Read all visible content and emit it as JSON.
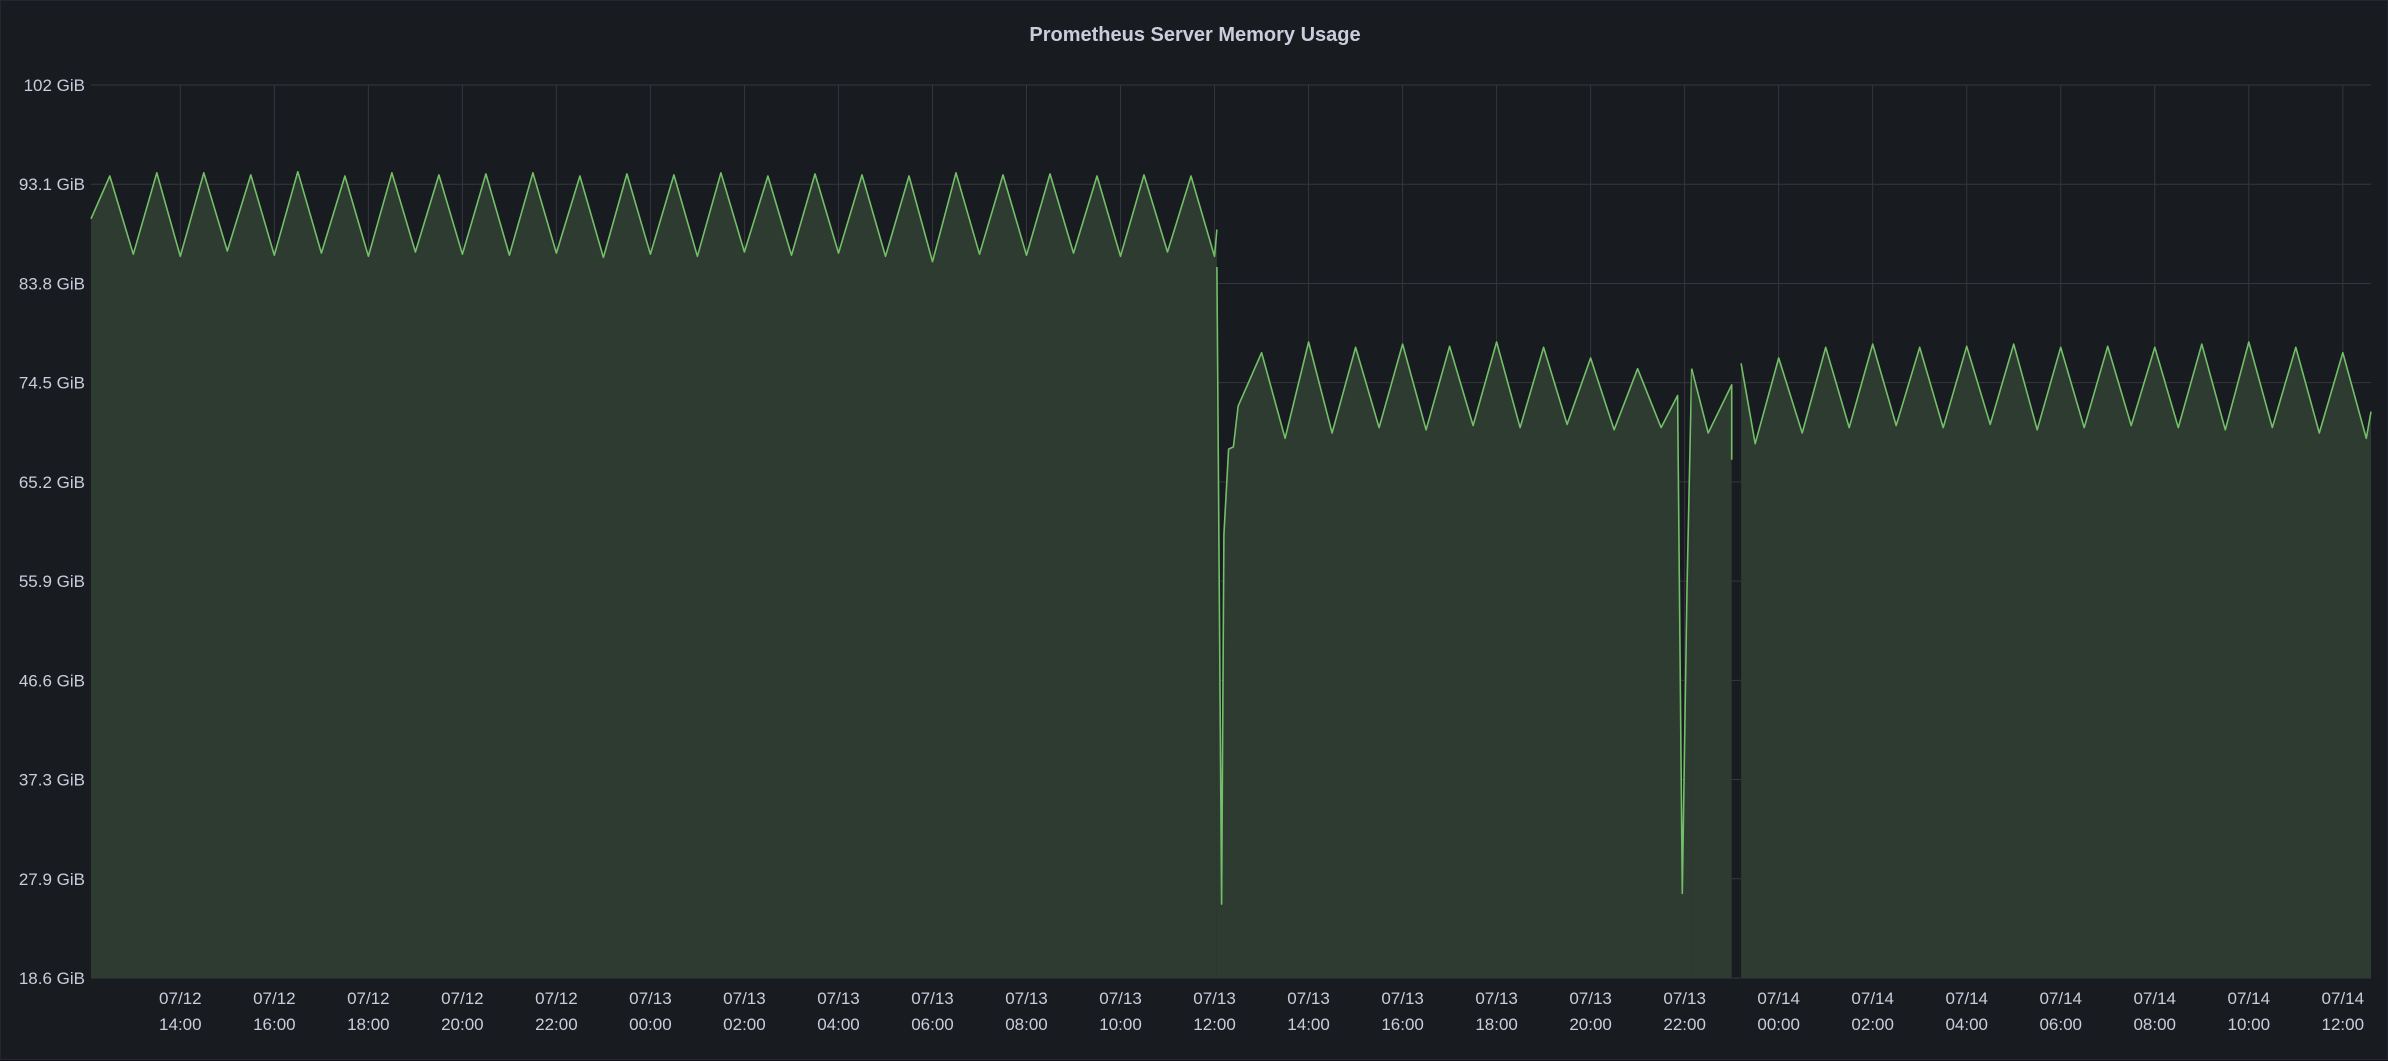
{
  "panel": {
    "title": "Prometheus Server Memory Usage"
  },
  "colors": {
    "background": "#181b1f",
    "grid": "#34373d",
    "series_line": "#73bf69",
    "series_fill": "#2e3b30",
    "gap": "#181b1f",
    "text": "#ccccdc"
  },
  "chart_data": {
    "type": "area",
    "title": "Prometheus Server Memory Usage",
    "xlabel": "",
    "ylabel": "",
    "unit": "GiB",
    "grid": true,
    "legend": "none",
    "ylim": [
      18.6,
      102
    ],
    "yticks": [
      "102 GiB",
      "93.1 GiB",
      "83.8 GiB",
      "74.5 GiB",
      "65.2 GiB",
      "55.9 GiB",
      "46.6 GiB",
      "37.3 GiB",
      "27.9 GiB",
      "18.6 GiB"
    ],
    "x_range_hours": [
      -1.9,
      46.6
    ],
    "x_units": "hours after 07/12 14:00",
    "xticks": [
      {
        "date": "07/12",
        "time": "14:00"
      },
      {
        "date": "07/12",
        "time": "16:00"
      },
      {
        "date": "07/12",
        "time": "18:00"
      },
      {
        "date": "07/12",
        "time": "20:00"
      },
      {
        "date": "07/12",
        "time": "22:00"
      },
      {
        "date": "07/13",
        "time": "00:00"
      },
      {
        "date": "07/13",
        "time": "02:00"
      },
      {
        "date": "07/13",
        "time": "04:00"
      },
      {
        "date": "07/13",
        "time": "06:00"
      },
      {
        "date": "07/13",
        "time": "08:00"
      },
      {
        "date": "07/13",
        "time": "10:00"
      },
      {
        "date": "07/13",
        "time": "12:00"
      },
      {
        "date": "07/13",
        "time": "14:00"
      },
      {
        "date": "07/13",
        "time": "16:00"
      },
      {
        "date": "07/13",
        "time": "18:00"
      },
      {
        "date": "07/13",
        "time": "20:00"
      },
      {
        "date": "07/13",
        "time": "22:00"
      },
      {
        "date": "07/14",
        "time": "00:00"
      },
      {
        "date": "07/14",
        "time": "02:00"
      },
      {
        "date": "07/14",
        "time": "04:00"
      },
      {
        "date": "07/14",
        "time": "06:00"
      },
      {
        "date": "07/14",
        "time": "08:00"
      },
      {
        "date": "07/14",
        "time": "10:00"
      },
      {
        "date": "07/14",
        "time": "12:00"
      }
    ],
    "series": [
      {
        "segments": [
          {
            "x": [
              -1.9,
              -1.5,
              -1.0,
              -0.5,
              0.0,
              0.5,
              1.0,
              1.5,
              2.0,
              2.5,
              3.0,
              3.5,
              4.0,
              4.5,
              5.0,
              5.5,
              6.0,
              6.5,
              7.0,
              7.5,
              8.0,
              8.5,
              9.0,
              9.5,
              10.0,
              10.5,
              11.0,
              11.5,
              12.0,
              12.5,
              13.0,
              13.5,
              14.0,
              14.5,
              15.0,
              15.5,
              16.0,
              16.5,
              17.0,
              17.5,
              18.0,
              18.5,
              19.0,
              19.5,
              20.0,
              20.5,
              21.0,
              21.5,
              22.0,
              22.05
            ],
            "y": [
              89.5,
              93.5,
              86.2,
              93.8,
              86.0,
              93.8,
              86.5,
              93.6,
              86.1,
              93.9,
              86.3,
              93.5,
              86.0,
              93.8,
              86.4,
              93.6,
              86.2,
              93.7,
              86.1,
              93.8,
              86.3,
              93.5,
              85.9,
              93.7,
              86.2,
              93.6,
              86.0,
              93.8,
              86.4,
              93.5,
              86.1,
              93.7,
              86.3,
              93.6,
              86.0,
              93.5,
              85.5,
              93.8,
              86.2,
              93.6,
              86.1,
              93.7,
              86.3,
              93.5,
              86.0,
              93.6,
              86.4,
              93.5,
              86.0,
              88.5
            ]
          },
          {
            "x": [
              22.05,
              22.15,
              22.2,
              22.3,
              22.4,
              22.5,
              23.0,
              23.5,
              24.0,
              24.5,
              25.0,
              25.5,
              26.0,
              26.5,
              27.0,
              27.5,
              28.0,
              28.5,
              29.0,
              29.5,
              30.0,
              30.5,
              31.0,
              31.5,
              31.85,
              31.95,
              32.05,
              32.15
            ],
            "y": [
              85.0,
              25.5,
              60.0,
              68.0,
              68.2,
              72.0,
              77.0,
              69.0,
              78.0,
              69.5,
              77.5,
              70.0,
              77.8,
              69.8,
              77.6,
              70.2,
              78.0,
              70.0,
              77.5,
              70.3,
              76.5,
              69.8,
              75.5,
              70.0,
              73.0,
              26.5,
              55.0,
              75.5
            ]
          },
          {
            "x": [
              32.15,
              32.5,
              33.0,
              33.0
            ],
            "y": [
              75.5,
              69.5,
              74.0,
              67.0
            ]
          },
          {
            "x": [
              33.2,
              33.5,
              34.0,
              34.5,
              35.0,
              35.5,
              36.0,
              36.5,
              37.0,
              37.5,
              38.0,
              38.5,
              39.0,
              39.5,
              40.0,
              40.5,
              41.0,
              41.5,
              42.0,
              42.5,
              43.0,
              43.5,
              44.0,
              44.5,
              45.0,
              45.5,
              46.0,
              46.5,
              46.6
            ],
            "y": [
              76.0,
              68.5,
              76.5,
              69.5,
              77.5,
              70.0,
              77.8,
              70.2,
              77.5,
              70.0,
              77.6,
              70.3,
              77.8,
              69.8,
              77.5,
              70.0,
              77.6,
              70.2,
              77.5,
              70.0,
              77.8,
              69.8,
              78.0,
              70.0,
              77.5,
              69.5,
              77.0,
              69.0,
              71.5
            ]
          }
        ]
      }
    ]
  }
}
